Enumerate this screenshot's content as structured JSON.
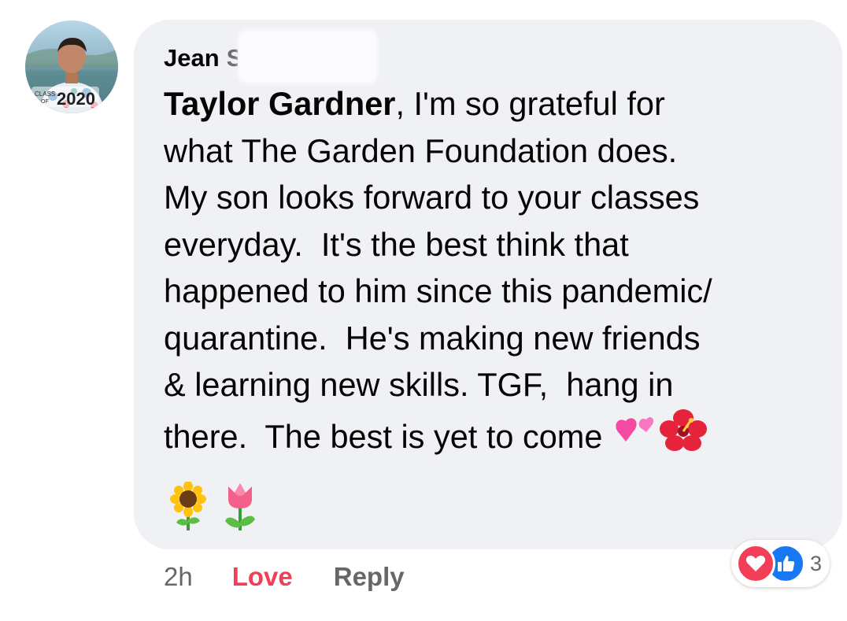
{
  "comment": {
    "author_first": "Jean",
    "author_last_partial": "S",
    "mention": "Taylor Gardner",
    "body": ", I'm so grateful for\nwhat The Garden Foundation does.\nMy son looks forward to your classes\neveryday.  It's the best think that\nhappened to him since this pandemic/\nquarantine.  He's making new friends\n& learning new skills. TGF,  hang in\nthere.  The best is yet to come ",
    "avatar_badge_small": "CLASS OF",
    "avatar_badge_year": "2020",
    "inline_emojis": [
      "two-hearts",
      "hibiscus"
    ],
    "trailing_emojis": [
      "sunflower",
      "tulip"
    ]
  },
  "actions": {
    "time": "2h",
    "love_label": "Love",
    "reply_label": "Reply"
  },
  "reactions": {
    "types": [
      "love",
      "like"
    ],
    "count": "3"
  },
  "colors": {
    "bubble": "#f0f1f4",
    "love": "#f33e58",
    "like": "#1877f2",
    "secondary_text": "#65676b"
  }
}
